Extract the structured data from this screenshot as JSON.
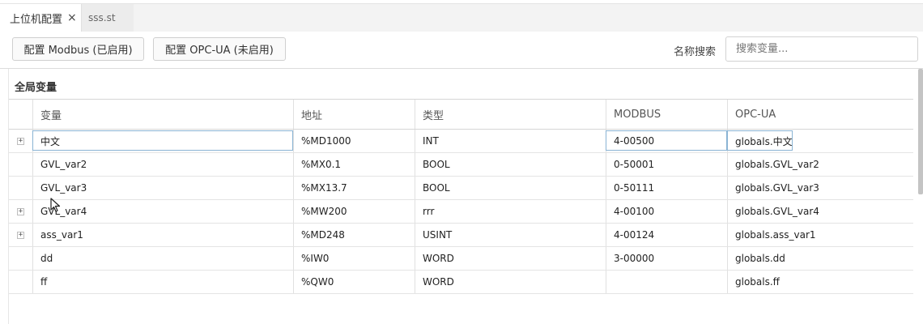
{
  "tabs": [
    {
      "label": "上位机配置",
      "close": "×"
    },
    {
      "label": "sss.st"
    }
  ],
  "toolbar": {
    "modbus_button": "配置 Modbus (已启用)",
    "opcua_button": "配置 OPC-UA (未启用)",
    "search_label": "名称搜索",
    "search_placeholder": "搜索变量...",
    "search_value": ""
  },
  "section": {
    "title": "全局变量"
  },
  "table": {
    "columns": [
      "变量",
      "地址",
      "类型",
      "MODBUS",
      "OPC-UA"
    ],
    "rows": [
      {
        "expand": "+",
        "name": "中文",
        "address": "%MD1000",
        "type": "INT",
        "modbus": "4-00500",
        "opcua": "globals.中文"
      },
      {
        "expand": "",
        "name": "GVL_var2",
        "address": "%MX0.1",
        "type": "BOOL",
        "modbus": "0-50001",
        "opcua": "globals.GVL_var2"
      },
      {
        "expand": "",
        "name": "GVL_var3",
        "address": "%MX13.7",
        "type": "BOOL",
        "modbus": "0-50111",
        "opcua": "globals.GVL_var3"
      },
      {
        "expand": "+",
        "name": "GVL_var4",
        "address": "%MW200",
        "type": "rrr",
        "modbus": "4-00100",
        "opcua": "globals.GVL_var4"
      },
      {
        "expand": "+",
        "name": "ass_var1",
        "address": "%MD248",
        "type": "USINT",
        "modbus": "4-00124",
        "opcua": "globals.ass_var1"
      },
      {
        "expand": "",
        "name": "dd",
        "address": "%IW0",
        "type": "WORD",
        "modbus": "3-00000",
        "opcua": "globals.dd"
      },
      {
        "expand": "",
        "name": "ff",
        "address": "%QW0",
        "type": "WORD",
        "modbus": "",
        "opcua": "globals.ff"
      }
    ]
  },
  "icons": {
    "expander": "plus-box-icon",
    "cursor": "mouse-pointer-icon"
  }
}
